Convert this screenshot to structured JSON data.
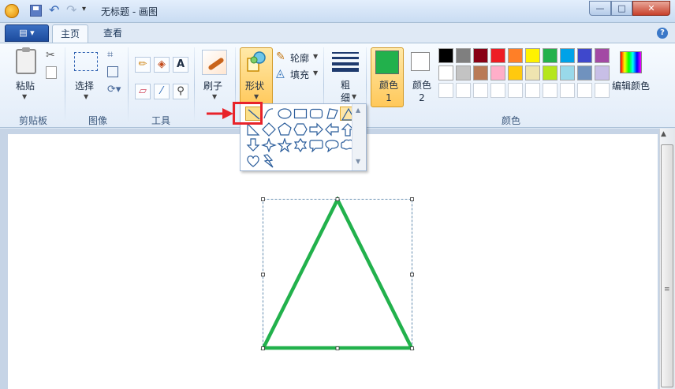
{
  "window": {
    "title": "无标题 - 画图",
    "minimize": "—",
    "maximize": "□",
    "close": "✕"
  },
  "quick_access": {
    "undo": "↶",
    "redo": "↷",
    "customize": "▾"
  },
  "tabs": {
    "app_menu": "▤ ▾",
    "home": "主页",
    "view": "查看",
    "help": "?"
  },
  "groups": {
    "clipboard": "剪贴板",
    "image": "图像",
    "tools": "工具",
    "colors": "颜色"
  },
  "clipboard": {
    "paste": "粘贴",
    "cut": "✂"
  },
  "image": {
    "select": "选择",
    "crop": "⌗",
    "rotate": "⟳▾"
  },
  "tools": {
    "pencil": "✏",
    "fill": "◈",
    "text": "A",
    "eraser": "▱",
    "picker": "⁄",
    "magnifier": "⚲"
  },
  "brush": {
    "label": "刷子"
  },
  "shapes": {
    "label": "形状",
    "outline": "轮廓",
    "fill": "填充",
    "items": [
      "line",
      "curve",
      "oval",
      "rectangle",
      "rounded-rectangle",
      "polygon",
      "triangle",
      "right-triangle",
      "diamond",
      "pentagon",
      "hexagon",
      "right-arrow",
      "left-arrow",
      "up-arrow",
      "down-arrow",
      "four-point-star",
      "five-point-star",
      "six-point-star",
      "rounded-callout",
      "oval-callout",
      "cloud-callout",
      "heart",
      "lightning"
    ],
    "selected": "line",
    "active": "triangle"
  },
  "size": {
    "label": "粗细"
  },
  "colors": {
    "color1_label": "颜色 1",
    "color2_label": "颜色 2",
    "color1": "#22b14c",
    "color2": "#ffffff",
    "edit_colors": "编辑颜色",
    "palette_row1": [
      "#000000",
      "#7f7f7f",
      "#880015",
      "#ed1c24",
      "#ff7f27",
      "#fff200",
      "#22b14c",
      "#00a2e8",
      "#3f48cc",
      "#a349a4"
    ],
    "palette_row2": [
      "#ffffff",
      "#c3c3c3",
      "#b97a57",
      "#ffaec9",
      "#ffc90e",
      "#efe4b0",
      "#b5e61d",
      "#99d9ea",
      "#7092be",
      "#c8bfe7"
    ],
    "palette_row3": [
      "#ffffff",
      "#ffffff",
      "#ffffff",
      "#ffffff",
      "#ffffff",
      "#ffffff",
      "#ffffff",
      "#ffffff",
      "#ffffff",
      "#ffffff"
    ]
  },
  "drawing": {
    "shape": "triangle",
    "stroke": "#22b14c"
  },
  "annotation": {
    "color": "#e8232a"
  }
}
